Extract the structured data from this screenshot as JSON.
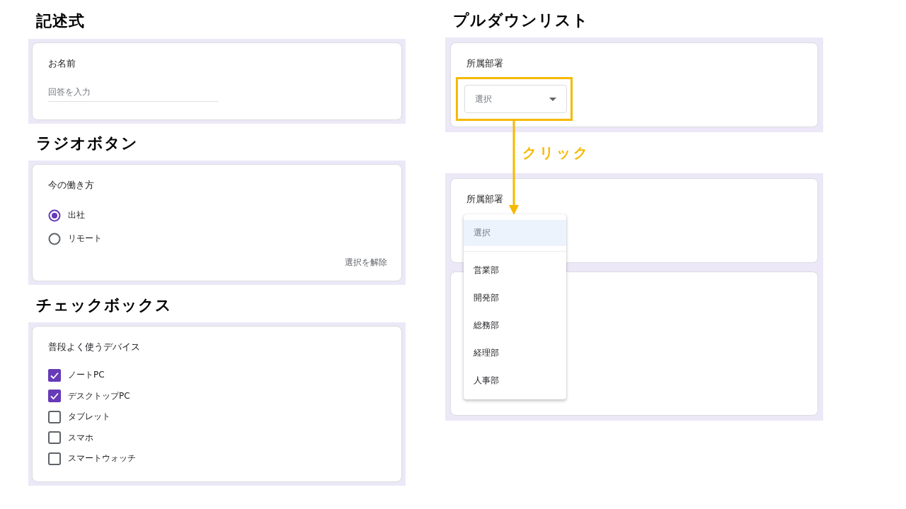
{
  "sections": [
    {
      "kind": "text",
      "heading": "記述式",
      "question": "お名前",
      "placeholder": "回答を入力"
    },
    {
      "kind": "radio",
      "heading": "ラジオボタン",
      "question": "今の働き方",
      "options": [
        {
          "label": "出社",
          "selected": true
        },
        {
          "label": "リモート",
          "selected": false
        }
      ],
      "clear": "選択を解除"
    },
    {
      "kind": "checkbox",
      "heading": "チェックボックス",
      "question": "普段よく使うデバイス",
      "options": [
        {
          "label": "ノートPC",
          "checked": true
        },
        {
          "label": "デスクトップPC",
          "checked": true
        },
        {
          "label": "タブレット",
          "checked": false
        },
        {
          "label": "スマホ",
          "checked": false
        },
        {
          "label": "スマートウォッチ",
          "checked": false
        }
      ]
    }
  ],
  "dropdown": {
    "heading": "プルダウンリスト",
    "question": "所属部署",
    "placeholder": "選択",
    "annotation": "クリック",
    "open_question": "所属部署",
    "menu": [
      {
        "label": "選択",
        "selected": true
      },
      {
        "label": "営業部",
        "selected": false
      },
      {
        "label": "開発部",
        "selected": false
      },
      {
        "label": "総務部",
        "selected": false
      },
      {
        "label": "経理部",
        "selected": false
      },
      {
        "label": "人事部",
        "selected": false
      }
    ]
  }
}
